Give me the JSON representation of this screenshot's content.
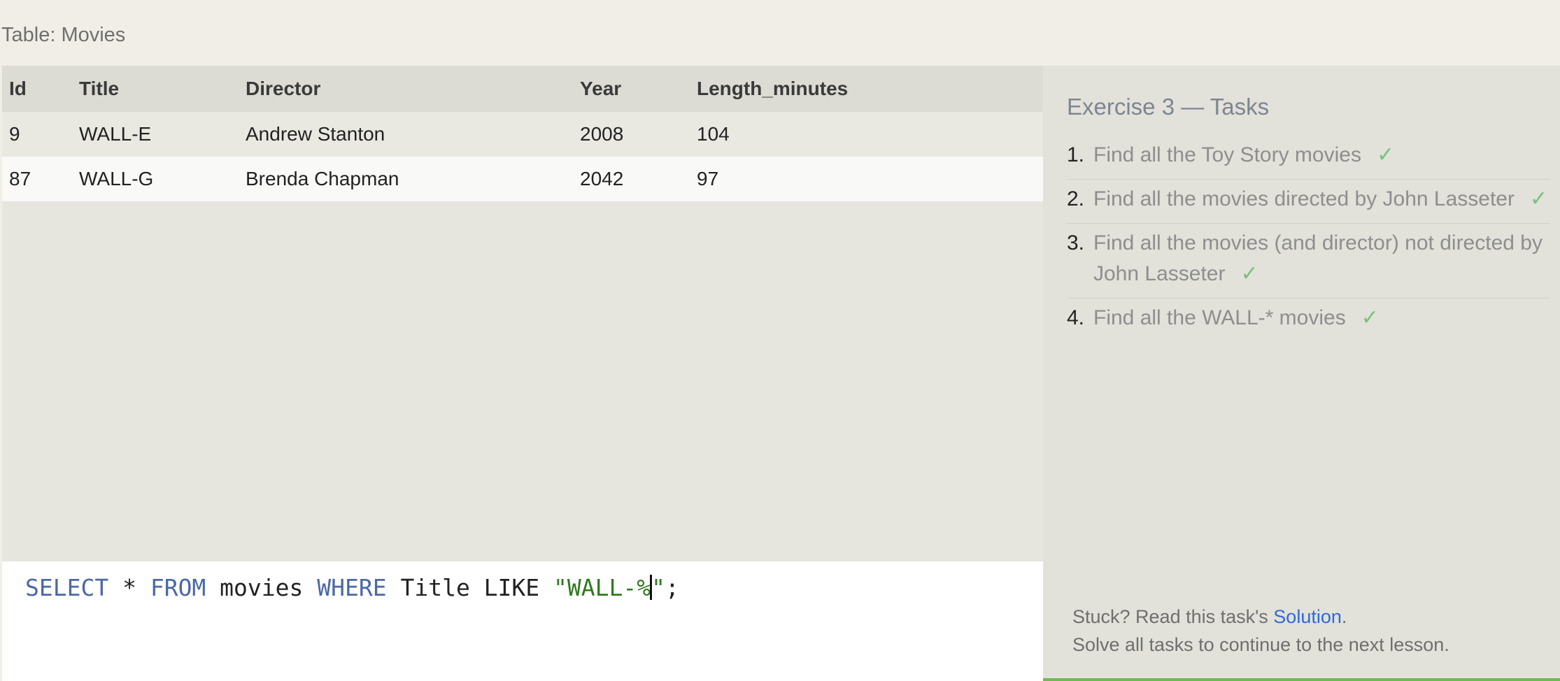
{
  "table_label": "Table: Movies",
  "table": {
    "columns": [
      "Id",
      "Title",
      "Director",
      "Year",
      "Length_minutes"
    ],
    "rows": [
      [
        "9",
        "WALL-E",
        "Andrew Stanton",
        "2008",
        "104"
      ],
      [
        "87",
        "WALL-G",
        "Brenda Chapman",
        "2042",
        "97"
      ]
    ]
  },
  "editor": {
    "tokens": [
      {
        "text": "SELECT",
        "type": "keyword"
      },
      {
        "text": " * ",
        "type": "plain"
      },
      {
        "text": "FROM",
        "type": "keyword"
      },
      {
        "text": " movies ",
        "type": "plain"
      },
      {
        "text": "WHERE",
        "type": "keyword"
      },
      {
        "text": " Title LIKE ",
        "type": "plain"
      },
      {
        "text": "\"WALL-%",
        "type": "string"
      },
      {
        "text": "\"",
        "type": "string"
      },
      {
        "text": ";",
        "type": "plain"
      }
    ]
  },
  "exercise": {
    "title": "Exercise 3 — Tasks",
    "tasks": [
      {
        "num": "1.",
        "text": "Find all the Toy Story movies",
        "check": "✓"
      },
      {
        "num": "2.",
        "text": "Find all the movies directed by John Lasseter",
        "check": "✓"
      },
      {
        "num": "3.",
        "text": "Find all the movies (and director) not directed by John Lasseter",
        "check": "✓"
      },
      {
        "num": "4.",
        "text": "Find all the WALL-* movies",
        "check": "✓"
      }
    ]
  },
  "help": {
    "stuck_prefix": "Stuck? Read this task's ",
    "solution_link": "Solution",
    "stuck_suffix": ".",
    "continue_text": "Solve all tasks to continue to the next lesson."
  },
  "colors": {
    "keyword": "#4b68a6",
    "string": "#2f7a1f",
    "check": "#77c27a",
    "link": "#2e6bd6",
    "progress_bar": "#6dbb55"
  }
}
